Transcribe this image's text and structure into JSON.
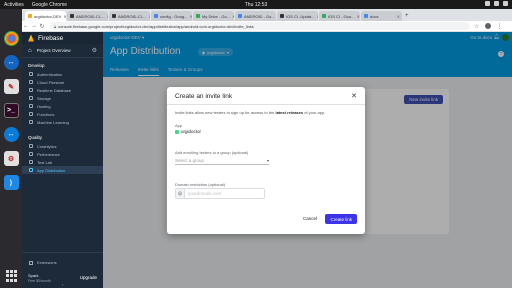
{
  "os": {
    "activities": "Activities",
    "app_name": "Google Chrome",
    "clock": "Thu 12:53"
  },
  "browser": {
    "tabs": [
      {
        "label": "urgidoctor-DEV",
        "active": true
      },
      {
        "label": "ANDROID-CI-..."
      },
      {
        "label": "ANDROID-CI-..."
      },
      {
        "label": "config - Goog..."
      },
      {
        "label": "My Drive - Go..."
      },
      {
        "label": "ANDROID - Go..."
      },
      {
        "label": "IOS CI -Updat..."
      },
      {
        "label": "IOS CI - Goo..."
      },
      {
        "label": "docs"
      }
    ],
    "url": "console.firebase.google.com/project/urgidoctor-dev/appdistribution/app/android:com.urgidoctor.dev/invite_links"
  },
  "sidebar": {
    "brand": "Firebase",
    "project_overview": "Project Overview",
    "sections": [
      {
        "title": "Develop",
        "items": [
          "Authentication",
          "Cloud Firestore",
          "Realtime Database",
          "Storage",
          "Hosting",
          "Functions",
          "Machine Learning"
        ]
      },
      {
        "title": "Quality",
        "items": [
          "Crashlytics",
          "Performance",
          "Test Lab",
          "App Distribution"
        ]
      }
    ],
    "extensions": "Extensions",
    "plan": "Spark",
    "plan_sub": "Free $0/month",
    "upgrade": "Upgrade"
  },
  "header": {
    "project": "urgidoctor-DEV",
    "goto_docs": "Go to docs",
    "title": "App Distribution",
    "app_chip": "urgidoctor",
    "tabs": [
      "Releases",
      "Invite links",
      "Testers & Groups"
    ]
  },
  "page": {
    "new_link_button": "New invite link"
  },
  "dialog": {
    "title": "Create an invite link",
    "description_prefix": "Invite links allow new testers to sign up for access to the",
    "description_bold": "latest releases",
    "description_suffix": "of your app.",
    "app_label": "App",
    "app_name": "urgidoctor",
    "group_label": "Add enrolling testers to a group (optional)",
    "group_placeholder": "Select a group",
    "domain_label": "Domain restriction (optional)",
    "domain_prefix": "@",
    "domain_placeholder": "yourdomain.com",
    "cancel": "Cancel",
    "create": "Create link"
  }
}
